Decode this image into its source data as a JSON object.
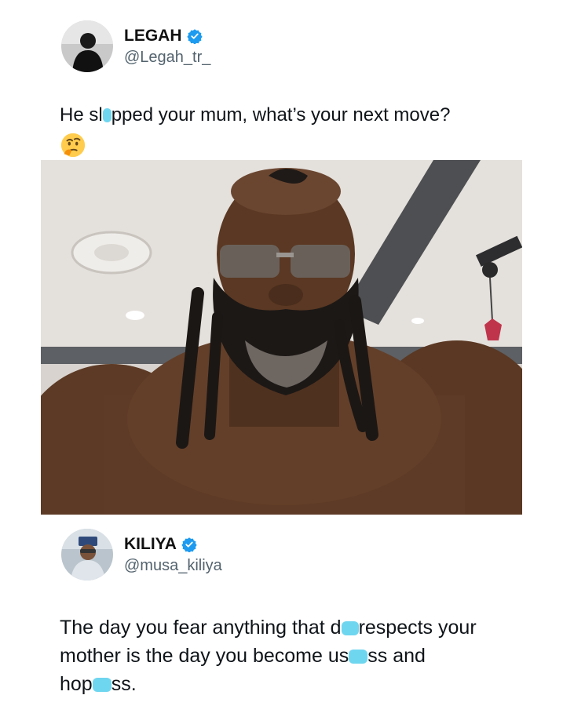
{
  "tweet1": {
    "display_name": "LEGAH",
    "handle": "@Legah_tr_",
    "text_before_censor": "He sl",
    "text_after_censor": "pped your mum, what’s your next move?",
    "emoji": "thinking-face-emoji"
  },
  "tweet2": {
    "display_name": "KILIYA",
    "handle": "@musa_kiliya",
    "line1_before": "The day you fear anything that d",
    "line1_after": "respects your",
    "line2_before": "mother is the day you become us",
    "line2_after": "ss and",
    "line3_before": "hop",
    "line3_after": "ss."
  },
  "colors": {
    "verified_badge": "#1d9bf0",
    "censor_highlight": "#6fd6f0",
    "handle_text": "#53636e"
  }
}
